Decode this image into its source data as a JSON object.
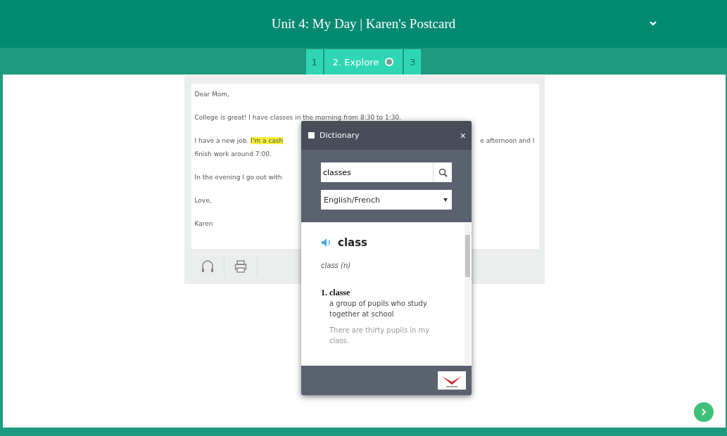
{
  "header": {
    "title": "Unit 4: My Day | Karen's Postcard"
  },
  "steps": [
    {
      "label": "1",
      "selected": false
    },
    {
      "label": "2. Explore",
      "selected": true
    },
    {
      "label": "3",
      "selected": false
    }
  ],
  "letter": {
    "greeting": "Dear Mom,",
    "line_1": "College is great! I have classes in the morning from 8:30 to 1:30.",
    "line_2_start": "I have a new job.",
    "line_2_highlight": "I'm a cash",
    "line_2_end": "e afternoon and I",
    "line_2_wrap": "finish work around 7:00.",
    "line_3": "In the evening I go out with",
    "closing": "Love,",
    "signature": "Karen"
  },
  "dictionary": {
    "title": "Dictionary",
    "close": "×",
    "search_value": "classes",
    "language": "English/French",
    "headword": "class",
    "part_of_speech": "class (n)",
    "senses": [
      {
        "number": "1.",
        "translation": "classe",
        "definition": "a group of pupils who study together at school",
        "example": "There are thirty pupils in my class."
      }
    ]
  }
}
